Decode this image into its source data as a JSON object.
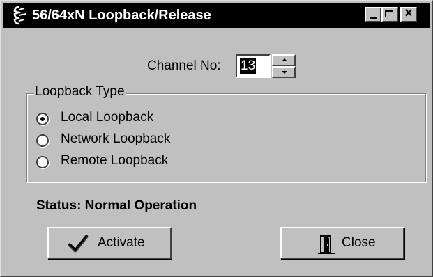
{
  "window": {
    "title": "56/64xN Loopback/Release"
  },
  "title_controls": {
    "minimize": "minimize",
    "maximize": "maximize",
    "close": "close"
  },
  "channel": {
    "label": "Channel No:",
    "value": "13"
  },
  "loopback": {
    "group_title": "Loopback Type",
    "options": [
      {
        "label": "Local Loopback",
        "selected": true
      },
      {
        "label": "Network Loopback",
        "selected": false
      },
      {
        "label": "Remote Loopback",
        "selected": false
      }
    ]
  },
  "status": {
    "text": "Status: Normal Operation"
  },
  "buttons": {
    "activate": "Activate",
    "close": "Close"
  },
  "icons": {
    "app": "app-icon",
    "activate": "checkmark-icon",
    "close": "door-exit-icon"
  }
}
